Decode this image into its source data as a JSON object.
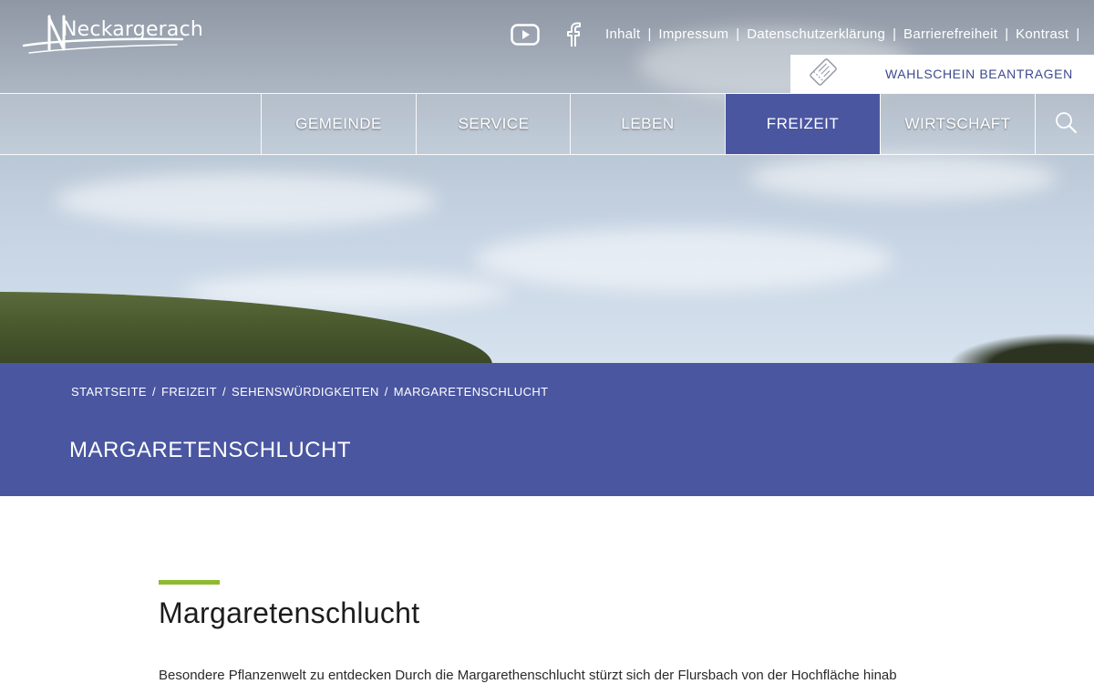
{
  "header": {
    "logo_text": "Neckargerach",
    "social": [
      {
        "icon": "youtube-icon"
      },
      {
        "icon": "facebook-icon"
      }
    ],
    "top_links": [
      "Inhalt",
      "Impressum",
      "Datenschutzerklärung",
      "Barrierefreiheit",
      "Kontrast"
    ],
    "top_link_separator": "|",
    "wahlschein": {
      "icon": "ticket-icon",
      "label": "WAHLSCHEIN BEANTRAGEN"
    }
  },
  "nav": {
    "items": [
      {
        "label": "GEMEINDE",
        "active": false
      },
      {
        "label": "SERVICE",
        "active": false
      },
      {
        "label": "LEBEN",
        "active": false
      },
      {
        "label": "FREIZEIT",
        "active": true
      },
      {
        "label": "WIRTSCHAFT",
        "active": false
      }
    ],
    "search_icon": "search-icon"
  },
  "breadcrumb": {
    "items": [
      "STARTSEITE",
      "FREIZEIT",
      "SEHENSWÜRDIGKEITEN",
      "MARGARETENSCHLUCHT"
    ],
    "separator": "/"
  },
  "page": {
    "band_title": "MARGARETENSCHLUCHT",
    "heading": "Margaretenschlucht",
    "intro": "Besondere Pflanzenwelt zu entdecken Durch die Margarethenschlucht stürzt sich der Flursbach von der Hochfläche hinab"
  },
  "colors": {
    "brand_blue": "#4a56a0",
    "accent_green": "#8dbb2d",
    "link_blue": "#3c4a8e"
  }
}
